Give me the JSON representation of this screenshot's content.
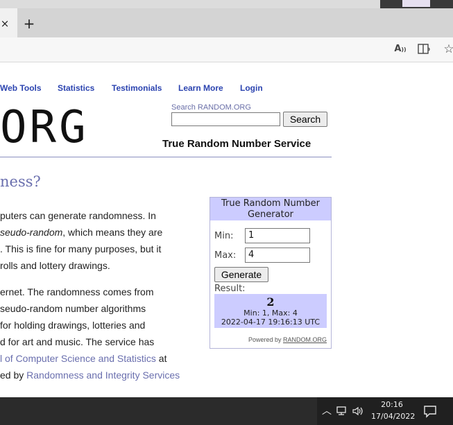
{
  "browser": {
    "tab_close": "×",
    "new_tab": "+",
    "icons": [
      "read-aloud-icon",
      "immersive-reader-icon",
      "favorites-icon"
    ],
    "read_aloud_label": "A",
    "favorites_label": "☆"
  },
  "site": {
    "nav": [
      "Web Tools",
      "Statistics",
      "Testimonials",
      "Learn More",
      "Login"
    ],
    "logo_text": "ORG",
    "search": {
      "label": "Search RANDOM.ORG",
      "value": "",
      "button_label": "Search"
    },
    "service_title": "True Random Number Service",
    "heading": "ness?",
    "paragraphs": [
      {
        "lines": [
          {
            "text": "puters can generate randomness. In"
          },
          {
            "italic": "seudo-random",
            "text": ", which means they are"
          },
          {
            "text": ". This is fine for many purposes, but it"
          },
          {
            "text": "rolls and lottery drawings."
          }
        ]
      },
      {
        "lines": [
          {
            "text": "ernet. The randomness comes from"
          },
          {
            "text": "seudo-random number algorithms"
          },
          {
            "text": "for holding drawings, lotteries and"
          },
          {
            "text": "d for art and music. The service has"
          },
          {
            "link": "l of Computer Science and Statistics",
            "text": " at"
          },
          {
            "text": "ed by ",
            "link": "Randomness and Integrity Services"
          }
        ]
      }
    ]
  },
  "widget": {
    "title": "True Random Number Generator",
    "min_label": "Min:",
    "min_value": "1",
    "max_label": "Max:",
    "max_value": "4",
    "generate_label": "Generate",
    "result_label": "Result:",
    "result_value": "2",
    "result_range": "Min: 1, Max: 4",
    "result_time": "2022-04-17 19:16:13 UTC",
    "powered_prefix": "Powered by ",
    "powered_link": "RANDOM.ORG",
    "title_bg": "#ccccff"
  },
  "taskbar": {
    "time": "20:16",
    "date": "17/04/2022",
    "tray_icons": [
      "chevron-up-icon",
      "network-icon",
      "volume-icon",
      "notification-icon"
    ],
    "chevron": "︿",
    "volume": "🔊"
  },
  "colors": {
    "link": "#2c44b0",
    "heading": "#6a6fae",
    "taskbar": "#2b2b2b"
  }
}
